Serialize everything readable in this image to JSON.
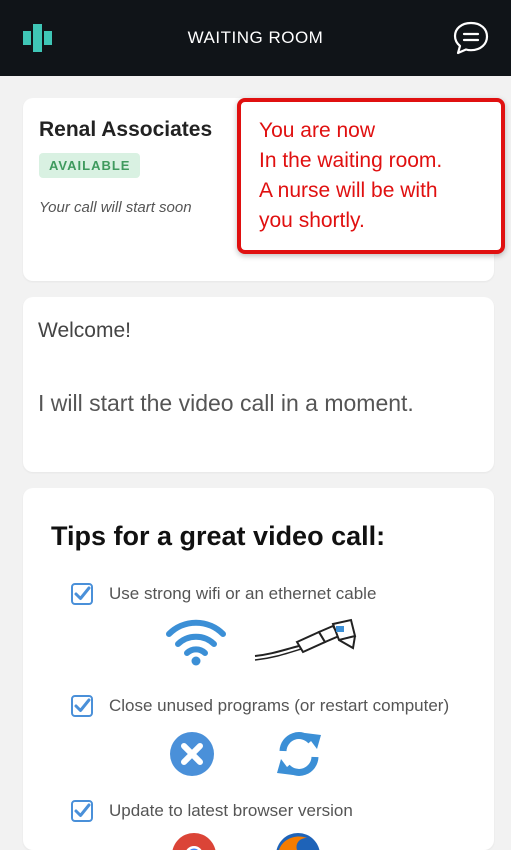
{
  "header": {
    "title": "WAITING ROOM",
    "logo_icon": "app-logo",
    "chat_icon": "chat-bubble-icon"
  },
  "clinic": {
    "name": "Renal Associates",
    "status": "AVAILABLE",
    "subtitle": "Your call will start soon"
  },
  "callout": {
    "lines": [
      "You are now",
      "In the waiting room.",
      "A nurse will be with",
      "you shortly."
    ],
    "color": "#e01010"
  },
  "welcome": {
    "heading": "Welcome!",
    "message": "I will start the video call in a moment."
  },
  "tips": {
    "title": "Tips for a great video call:",
    "items": [
      {
        "label": "Use strong wifi or an ethernet cable",
        "checked": true,
        "icons": [
          "wifi-icon",
          "ethernet-cable-icon"
        ]
      },
      {
        "label": "Close unused programs (or restart computer)",
        "checked": true,
        "icons": [
          "close-program-icon",
          "restart-icon"
        ]
      },
      {
        "label": "Update to latest browser version",
        "checked": true,
        "icons": [
          "chrome-icon",
          "firefox-icon"
        ]
      }
    ]
  },
  "colors": {
    "topbar": "#101418",
    "accent_blue": "#4a90d9",
    "badge_green": "#3f9a5e",
    "callout_red": "#e01010"
  }
}
